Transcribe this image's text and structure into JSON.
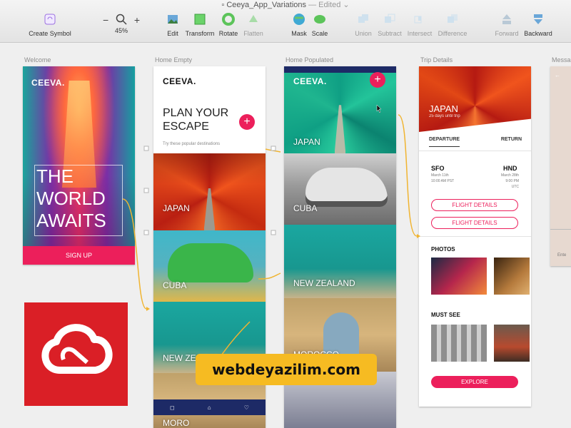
{
  "window": {
    "title": "Ceeya_App_Variations",
    "status": "Edited"
  },
  "toolbar": {
    "create_symbol": "Create Symbol",
    "zoom_minus": "−",
    "zoom_plus": "+",
    "zoom_level": "45%",
    "edit": "Edit",
    "transform": "Transform",
    "rotate": "Rotate",
    "flatten": "Flatten",
    "mask": "Mask",
    "scale": "Scale",
    "union": "Union",
    "subtract": "Subtract",
    "intersect": "Intersect",
    "difference": "Difference",
    "forward": "Forward",
    "backward": "Backward"
  },
  "artboard_labels": {
    "welcome": "Welcome",
    "home_empty": "Home Empty",
    "home_populated": "Home Populated",
    "trip_details": "Trip Details",
    "partial": "Messa"
  },
  "welcome": {
    "logo": "CEEVA.",
    "headline_1": "THE",
    "headline_2": "WORLD",
    "headline_3": "AWAITS",
    "signup": "SIGN UP"
  },
  "home_empty": {
    "logo": "CEEVA.",
    "title_1": "PLAN YOUR",
    "title_2": "ESCAPE",
    "subtitle": "Try these popular destinations",
    "plus": "+",
    "destinations": [
      "JAPAN",
      "CUBA",
      "NEW ZEALAND",
      "MORO"
    ]
  },
  "home_populated": {
    "logo": "CEEVA.",
    "plus": "+",
    "destinations": [
      "JAPAN",
      "CUBA",
      "NEW ZEALAND",
      "MOROCCO"
    ]
  },
  "trip_details": {
    "title": "JAPAN",
    "subtitle": "25 days until trip",
    "tab_departure": "DEPARTURE",
    "tab_return": "RETURN",
    "from_code": "SFO",
    "from_date": "March 11th",
    "from_time": "10:00 AM PST",
    "to_code": "HND",
    "to_date": "March 28th",
    "to_time": "9:00 PM UTC",
    "flight_details_1": "FLIGHT DETAILS",
    "flight_details_2": "FLIGHT DETAILS",
    "photos": "PHOTOS",
    "must_see": "MUST SEE",
    "explore": "EXPLORE"
  },
  "partial": {
    "input_hint": "Ente"
  },
  "watermark": "webdeyazilim.com",
  "colors": {
    "accent": "#ec1f5b",
    "navy": "#1d2a66",
    "adobe_red": "#da1f26",
    "watermark_bg": "#f6bb22"
  }
}
